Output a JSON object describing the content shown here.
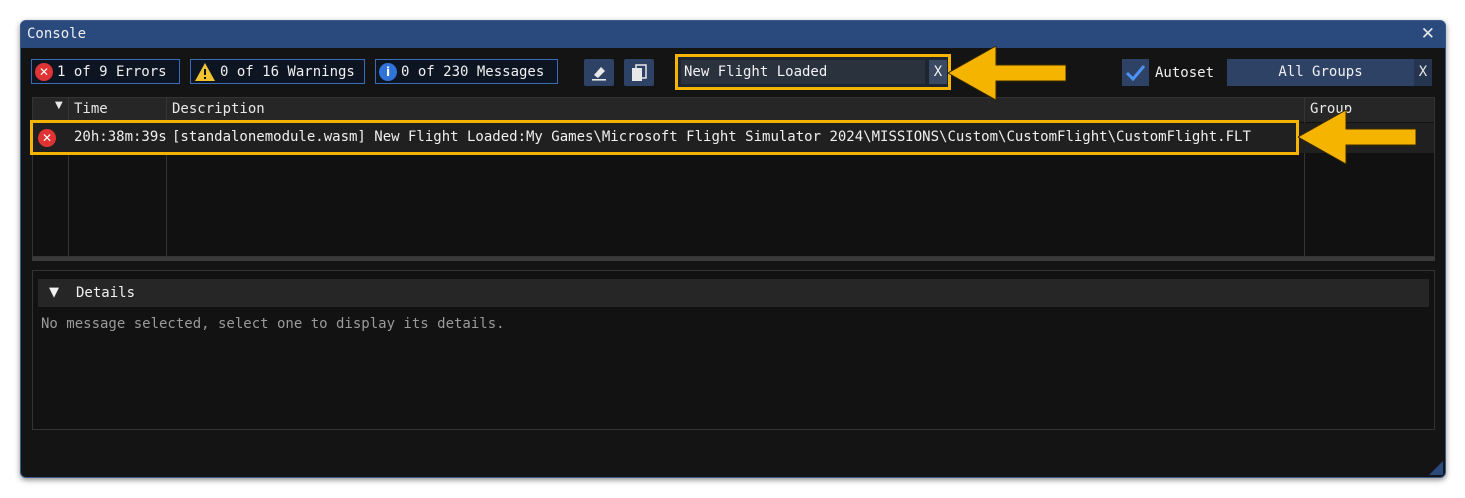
{
  "window": {
    "title": "Console"
  },
  "filters": {
    "errors": "1 of 9 Errors",
    "warnings": "0 of 16 Warnings",
    "messages": "0 of 230 Messages"
  },
  "search": {
    "value": "New Flight Loaded",
    "clear_label": "X"
  },
  "autoset": {
    "label": "Autoset",
    "checked": true
  },
  "groups": {
    "selected": "All Groups",
    "clear_label": "X"
  },
  "table": {
    "columns": {
      "time": "Time",
      "description": "Description",
      "group": "Group"
    },
    "rows": [
      {
        "severity": "error",
        "time": "20h:38m:39s",
        "description": "[standalonemodule.wasm] New Flight Loaded:My Games\\Microsoft Flight Simulator 2024\\MISSIONS\\Custom\\CustomFlight\\CustomFlight.FLT"
      }
    ]
  },
  "details": {
    "title": "Details",
    "empty_text": "No message selected, select one to display its details."
  },
  "colors": {
    "accent": "#2a4a7e",
    "highlight": "#f5b400",
    "error": "#e03434",
    "info": "#2f73d9"
  }
}
